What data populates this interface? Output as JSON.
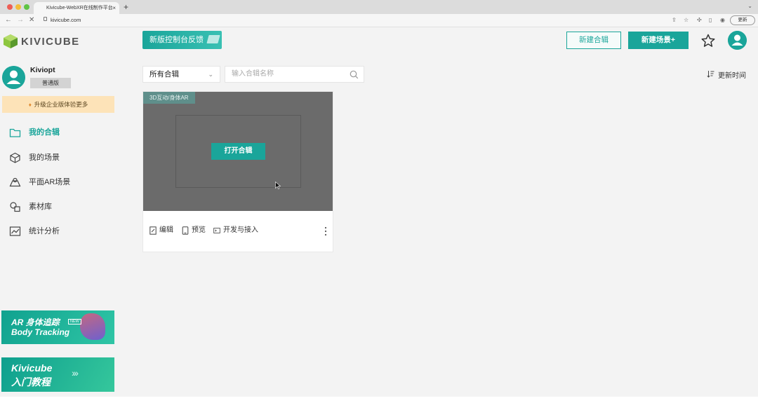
{
  "browser": {
    "tab_title": "Kivicube-WebXR在线制作平台",
    "tab_close": "×",
    "new_tab": "+",
    "tab_menu": "⌄",
    "url": "kivicube.com",
    "back": "←",
    "forward": "→",
    "reload": "✕",
    "update_label": "更新",
    "right_icons": [
      "share-icon",
      "bookmark-star-icon",
      "extensions-icon",
      "sidebar-icon",
      "profile-icon"
    ]
  },
  "header": {
    "logo_text": "KIVICUBE",
    "feedback_label": "新版控制台反馈",
    "new_collection_label": "新建合辑",
    "new_scene_label": "新建场景+",
    "accent": "#1aa59a"
  },
  "sidebar": {
    "username": "Kiviopt",
    "plan": "普通版",
    "upgrade_label": "升级企业版体验更多",
    "items": [
      {
        "label": "我的合辑",
        "icon": "folder-icon",
        "active": true
      },
      {
        "label": "我的场景",
        "icon": "cube-icon",
        "active": false
      },
      {
        "label": "平面AR场景",
        "icon": "plane-ar-icon",
        "active": false
      },
      {
        "label": "素材库",
        "icon": "materials-icon",
        "active": false
      },
      {
        "label": "统计分析",
        "icon": "analytics-icon",
        "active": false
      }
    ],
    "banner1": {
      "line1": "AR 身体追踪",
      "line2": "Body Tracking",
      "tag": "NEW"
    },
    "banner2": {
      "line1": "Kivicube",
      "line2": "入门教程",
      "arrows": "›››"
    }
  },
  "main": {
    "filter_value": "所有合辑",
    "search_placeholder": "输入合辑名称",
    "sort_label": "更新时间",
    "card": {
      "tag": "3D互动/身体AR",
      "open_label": "打开合辑",
      "actions": [
        "编辑",
        "预览",
        "开发与接入"
      ]
    }
  }
}
